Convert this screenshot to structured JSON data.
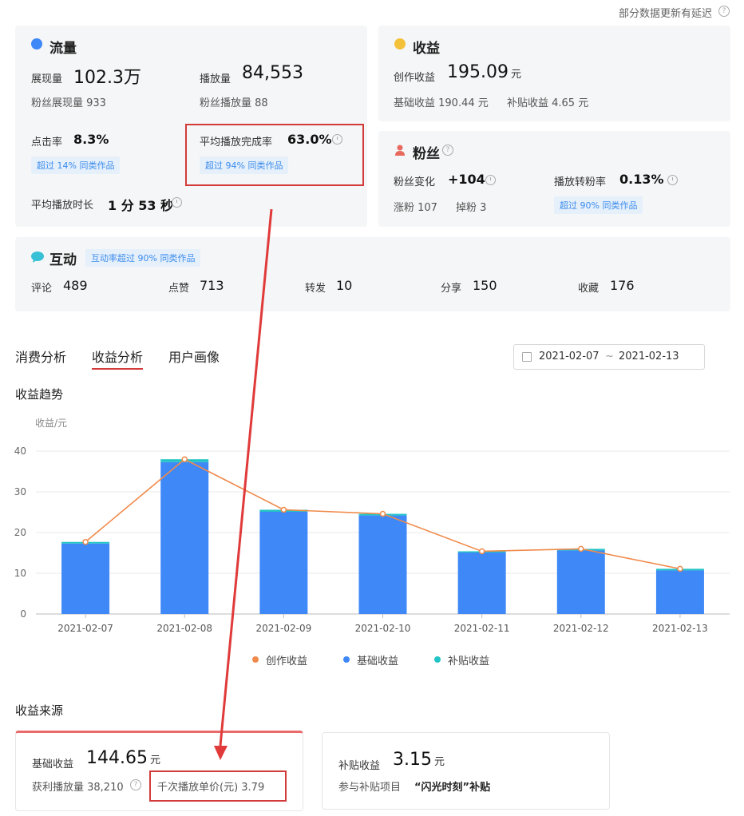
{
  "top_note": "部分数据更新有延迟",
  "traffic": {
    "title": "流量",
    "impressions_label": "展现量",
    "impressions_value": "102.3万",
    "plays_label": "播放量",
    "plays_value": "84,553",
    "fan_impressions": "粉丝展现量 933",
    "fan_plays": "粉丝播放量 88",
    "ctr_label": "点击率",
    "ctr_value": "8.3%",
    "ctr_tag": "超过 14% 同类作品",
    "completion_label": "平均播放完成率",
    "completion_value": "63.0%",
    "completion_tag": "超过 94% 同类作品",
    "duration_label": "平均播放时长",
    "duration_value": "1 分 53 秒"
  },
  "revenue": {
    "title": "收益",
    "creation_label": "创作收益",
    "creation_value": "195.09",
    "unit": "元",
    "base_text": "基础收益 190.44 元",
    "subsidy_text": "补贴收益 4.65 元"
  },
  "fans": {
    "title": "粉丝",
    "change_label": "粉丝变化",
    "change_value": "+104",
    "conv_label": "播放转粉率",
    "conv_value": "0.13%",
    "gain": "涨粉 107",
    "loss": "掉粉 3",
    "conv_tag": "超过 90% 同类作品"
  },
  "interaction": {
    "title": "互动",
    "tag": "互动率超过 90% 同类作品",
    "items": [
      {
        "label": "评论",
        "value": "489"
      },
      {
        "label": "点赞",
        "value": "713"
      },
      {
        "label": "转发",
        "value": "10"
      },
      {
        "label": "分享",
        "value": "150"
      },
      {
        "label": "收藏",
        "value": "176"
      }
    ]
  },
  "tabs": [
    "消费分析",
    "收益分析",
    "用户画像"
  ],
  "date_range": {
    "start": "2021-02-07",
    "sep": "~",
    "end": "2021-02-13"
  },
  "trend_title": "收益趋势",
  "chart_data": {
    "type": "bar",
    "ylabel": "收益/元",
    "ylim": [
      0,
      40
    ],
    "yticks": [
      0,
      10,
      20,
      30,
      40
    ],
    "categories": [
      "2021-02-07",
      "2021-02-08",
      "2021-02-09",
      "2021-02-10",
      "2021-02-11",
      "2021-02-12",
      "2021-02-13"
    ],
    "series": [
      {
        "name": "基础收益",
        "type": "bar",
        "color": "#3e88f7",
        "values": [
          17.3,
          37.3,
          25.1,
          24.2,
          15.1,
          15.6,
          10.7
        ]
      },
      {
        "name": "补贴收益",
        "type": "bar",
        "color": "#23c4c6",
        "values": [
          0.4,
          0.7,
          0.5,
          0.4,
          0.3,
          0.4,
          0.4
        ]
      },
      {
        "name": "创作收益",
        "type": "line",
        "color": "#f08a4b",
        "values": [
          17.7,
          38.0,
          25.6,
          24.6,
          15.4,
          16.0,
          11.1
        ]
      }
    ]
  },
  "legend": [
    {
      "name": "创作收益",
      "color": "#f08a4b"
    },
    {
      "name": "基础收益",
      "color": "#3e88f7"
    },
    {
      "name": "补贴收益",
      "color": "#23c4c6"
    }
  ],
  "source_title": "收益来源",
  "source_base": {
    "label": "基础收益",
    "value": "144.65",
    "unit": "元",
    "profit_plays": "获利播放量 38,210",
    "cpm": "千次播放单价(元) 3.79"
  },
  "source_subsidy": {
    "label": "补贴收益",
    "value": "3.15",
    "unit": "元",
    "project_prefix": "参与补贴项目",
    "project_name": "“闪光时刻”补贴"
  }
}
